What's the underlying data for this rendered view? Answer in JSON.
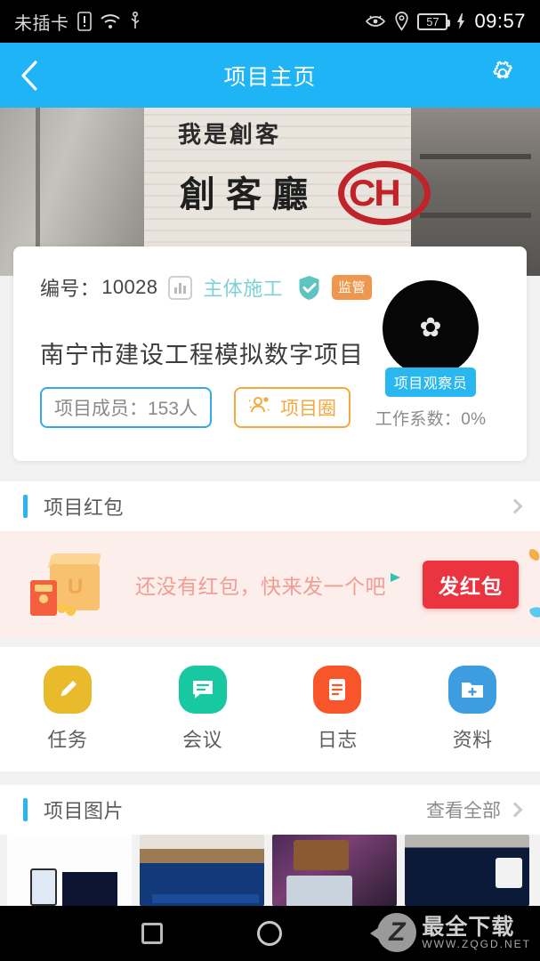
{
  "status_bar": {
    "carrier": "未插卡",
    "icons_left": [
      "sim-alert-icon",
      "wifi-icon",
      "usb-icon"
    ],
    "icons_right": [
      "eye-icon",
      "location-icon"
    ],
    "battery": "57",
    "charging_icon": "charging-bolt-icon",
    "time": "09:57"
  },
  "header": {
    "title": "项目主页",
    "back_icon": "back-chevron-icon",
    "settings_icon": "gear-icon",
    "background_color": "#1EB4F5"
  },
  "hero": {
    "wall_text_top": "我是創客",
    "wall_text_main": "創客廳",
    "logo_text": "CH",
    "logo_color": "#C0232A"
  },
  "project_card": {
    "code_label": "编号：",
    "code_value": "10028",
    "stage_icon": "bar-chart-icon",
    "stage_label": "主体施工",
    "stage_color": "#7ED0D5",
    "verified_icon": "shield-check-icon",
    "supervision_badge": "监管",
    "supervision_color": "#F0974F",
    "title": "南宁市建设工程模拟数字项目",
    "members_button": "项目成员：153人",
    "circle_button": "项目圈",
    "circle_icon": "people-group-icon",
    "avatar_icon": "star-avatar-icon",
    "role_badge": "项目观察员",
    "role_badge_color": "#28B7F0",
    "work_coefficient": "工作系数：0%"
  },
  "red_packet_section": {
    "title": "项目红包",
    "chevron_icon": "chevron-right-icon",
    "empty_text": "还没有红包，快来发一个吧",
    "button_label": "发红包",
    "button_color": "#EA3440",
    "gift_icon": "gift-box-icon"
  },
  "quick_actions": [
    {
      "label": "任务",
      "icon": "pencil-icon",
      "color": "#E9BA2B"
    },
    {
      "label": "会议",
      "icon": "chat-bubble-icon",
      "color": "#17C8A0"
    },
    {
      "label": "日志",
      "icon": "document-icon",
      "color": "#F9552A"
    },
    {
      "label": "资料",
      "icon": "folder-plus-icon",
      "color": "#3E9DE0"
    }
  ],
  "gallery_section": {
    "title": "项目图片",
    "view_all": "查看全部",
    "chevron_icon": "chevron-right-icon",
    "thumbnails": [
      "thumb-app-screenshot",
      "thumb-blue-banner",
      "thumb-laptop-desk",
      "thumb-dark-dashboard"
    ]
  },
  "nav_bar": {
    "recents_icon": "square-recents-icon",
    "home_icon": "circle-home-icon",
    "back_icon": "triangle-back-icon"
  },
  "watermark": {
    "logo": "Z",
    "title": "最全下载",
    "url": "WWW.ZQGD.NET"
  }
}
